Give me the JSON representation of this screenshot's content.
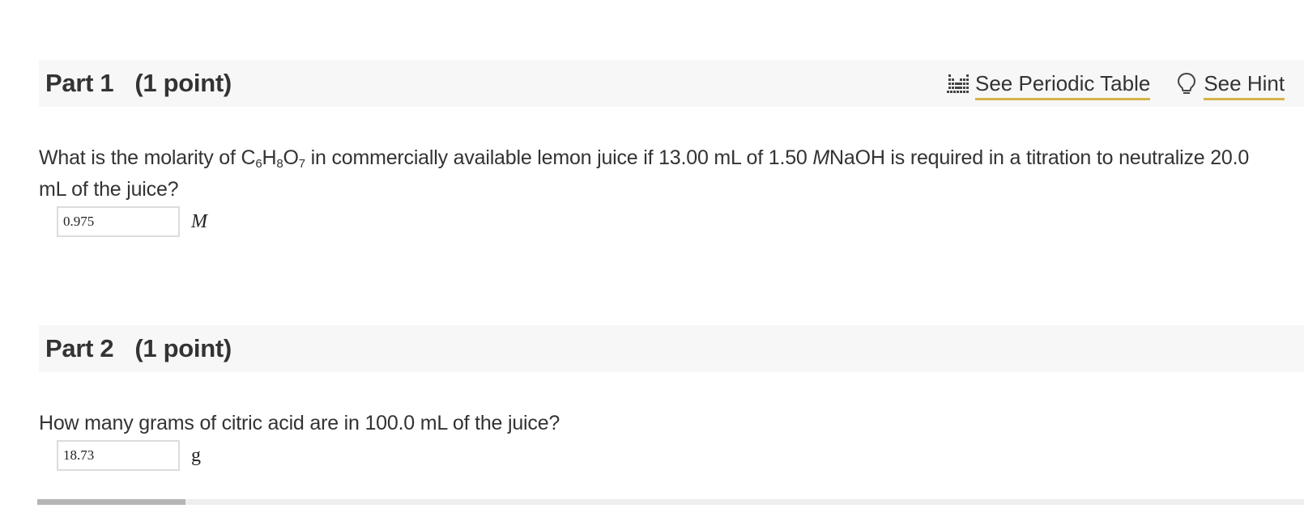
{
  "part1": {
    "label": "Part 1",
    "points": "(1 point)",
    "tools": {
      "periodic_table_label": "See Periodic Table",
      "periodic_table_icon": "periodic-table-icon",
      "hint_label": "See Hint",
      "hint_icon": "lightbulb-icon"
    },
    "question": {
      "prefix": "What is the molarity of C",
      "sub1": "6",
      "h": "H",
      "sub2": "8",
      "o": "O",
      "sub3": "7",
      "middle": " in commercially available lemon juice if 13.00 mL of 1.50 ",
      "molar": "M",
      "suffix": "NaOH is required in a titration to neutralize 20.0 mL of the juice?"
    },
    "answer": {
      "value": "0.975",
      "unit": "M"
    }
  },
  "part2": {
    "label": "Part 2",
    "points": "(1 point)",
    "question": "How many grams of citric acid are in 100.0 mL of the juice?",
    "answer": {
      "value": "18.73",
      "unit": "g"
    }
  },
  "colors": {
    "link_underline": "#d6b348",
    "header_background": "#f7f7f7",
    "text": "#333333"
  }
}
